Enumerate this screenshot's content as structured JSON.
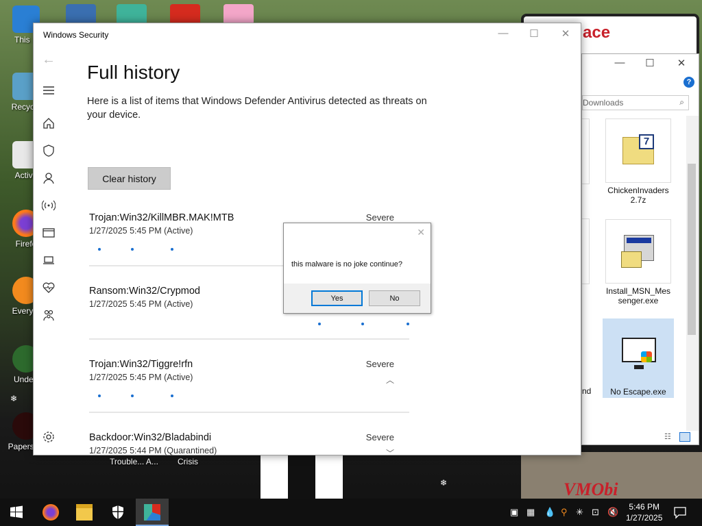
{
  "desktop": {
    "icons": [
      {
        "label": "This P"
      },
      {
        "label": "Recycle"
      },
      {
        "label": "Activa"
      },
      {
        "label": "Firefo"
      },
      {
        "label": "Everyth"
      },
      {
        "label": "Undert"
      },
      {
        "label": "Papers, P"
      }
    ],
    "bottom_labels": [
      "Trouble... A...",
      "Crisis"
    ]
  },
  "windows_security": {
    "title": "Windows Security",
    "heading": "Full history",
    "description": "Here is a list of items that Windows Defender Antivirus detected as threats on your device.",
    "clear_button": "Clear history",
    "threats": [
      {
        "name": "Trojan:Win32/KillMBR.MAK!MTB",
        "date": "1/27/2025 5:45 PM (Active)",
        "severity": "Severe"
      },
      {
        "name": "Ransom:Win32/Crypmod",
        "date": "1/27/2025 5:45 PM (Active)",
        "severity": ""
      },
      {
        "name": "Trojan:Win32/Tiggre!rfn",
        "date": "1/27/2025 5:45 PM (Active)",
        "severity": "Severe"
      },
      {
        "name": "Backdoor:Win32/Bladabindi",
        "date": "1/27/2025 5:44 PM (Quarantined)",
        "severity": "Severe"
      }
    ]
  },
  "explorer": {
    "search_placeholder": "Downloads",
    "help": "?",
    "files": [
      {
        "name": "ChickenInvaders 2.7z"
      },
      {
        "name": "Install_MSN_Mes senger.exe"
      },
      {
        "name": "No Escape.exe"
      }
    ],
    "partial_label": "nd"
  },
  "dialog": {
    "message": "this malware is no joke continue?",
    "yes": "Yes",
    "no": "No"
  },
  "taskbar": {
    "time": "5:46 PM",
    "date": "1/27/2025"
  },
  "background": {
    "sign_text": "ace",
    "road_text": "VMObi"
  },
  "colors": {
    "accent": "#0078d7",
    "link_dots": "#1a6fd0"
  }
}
